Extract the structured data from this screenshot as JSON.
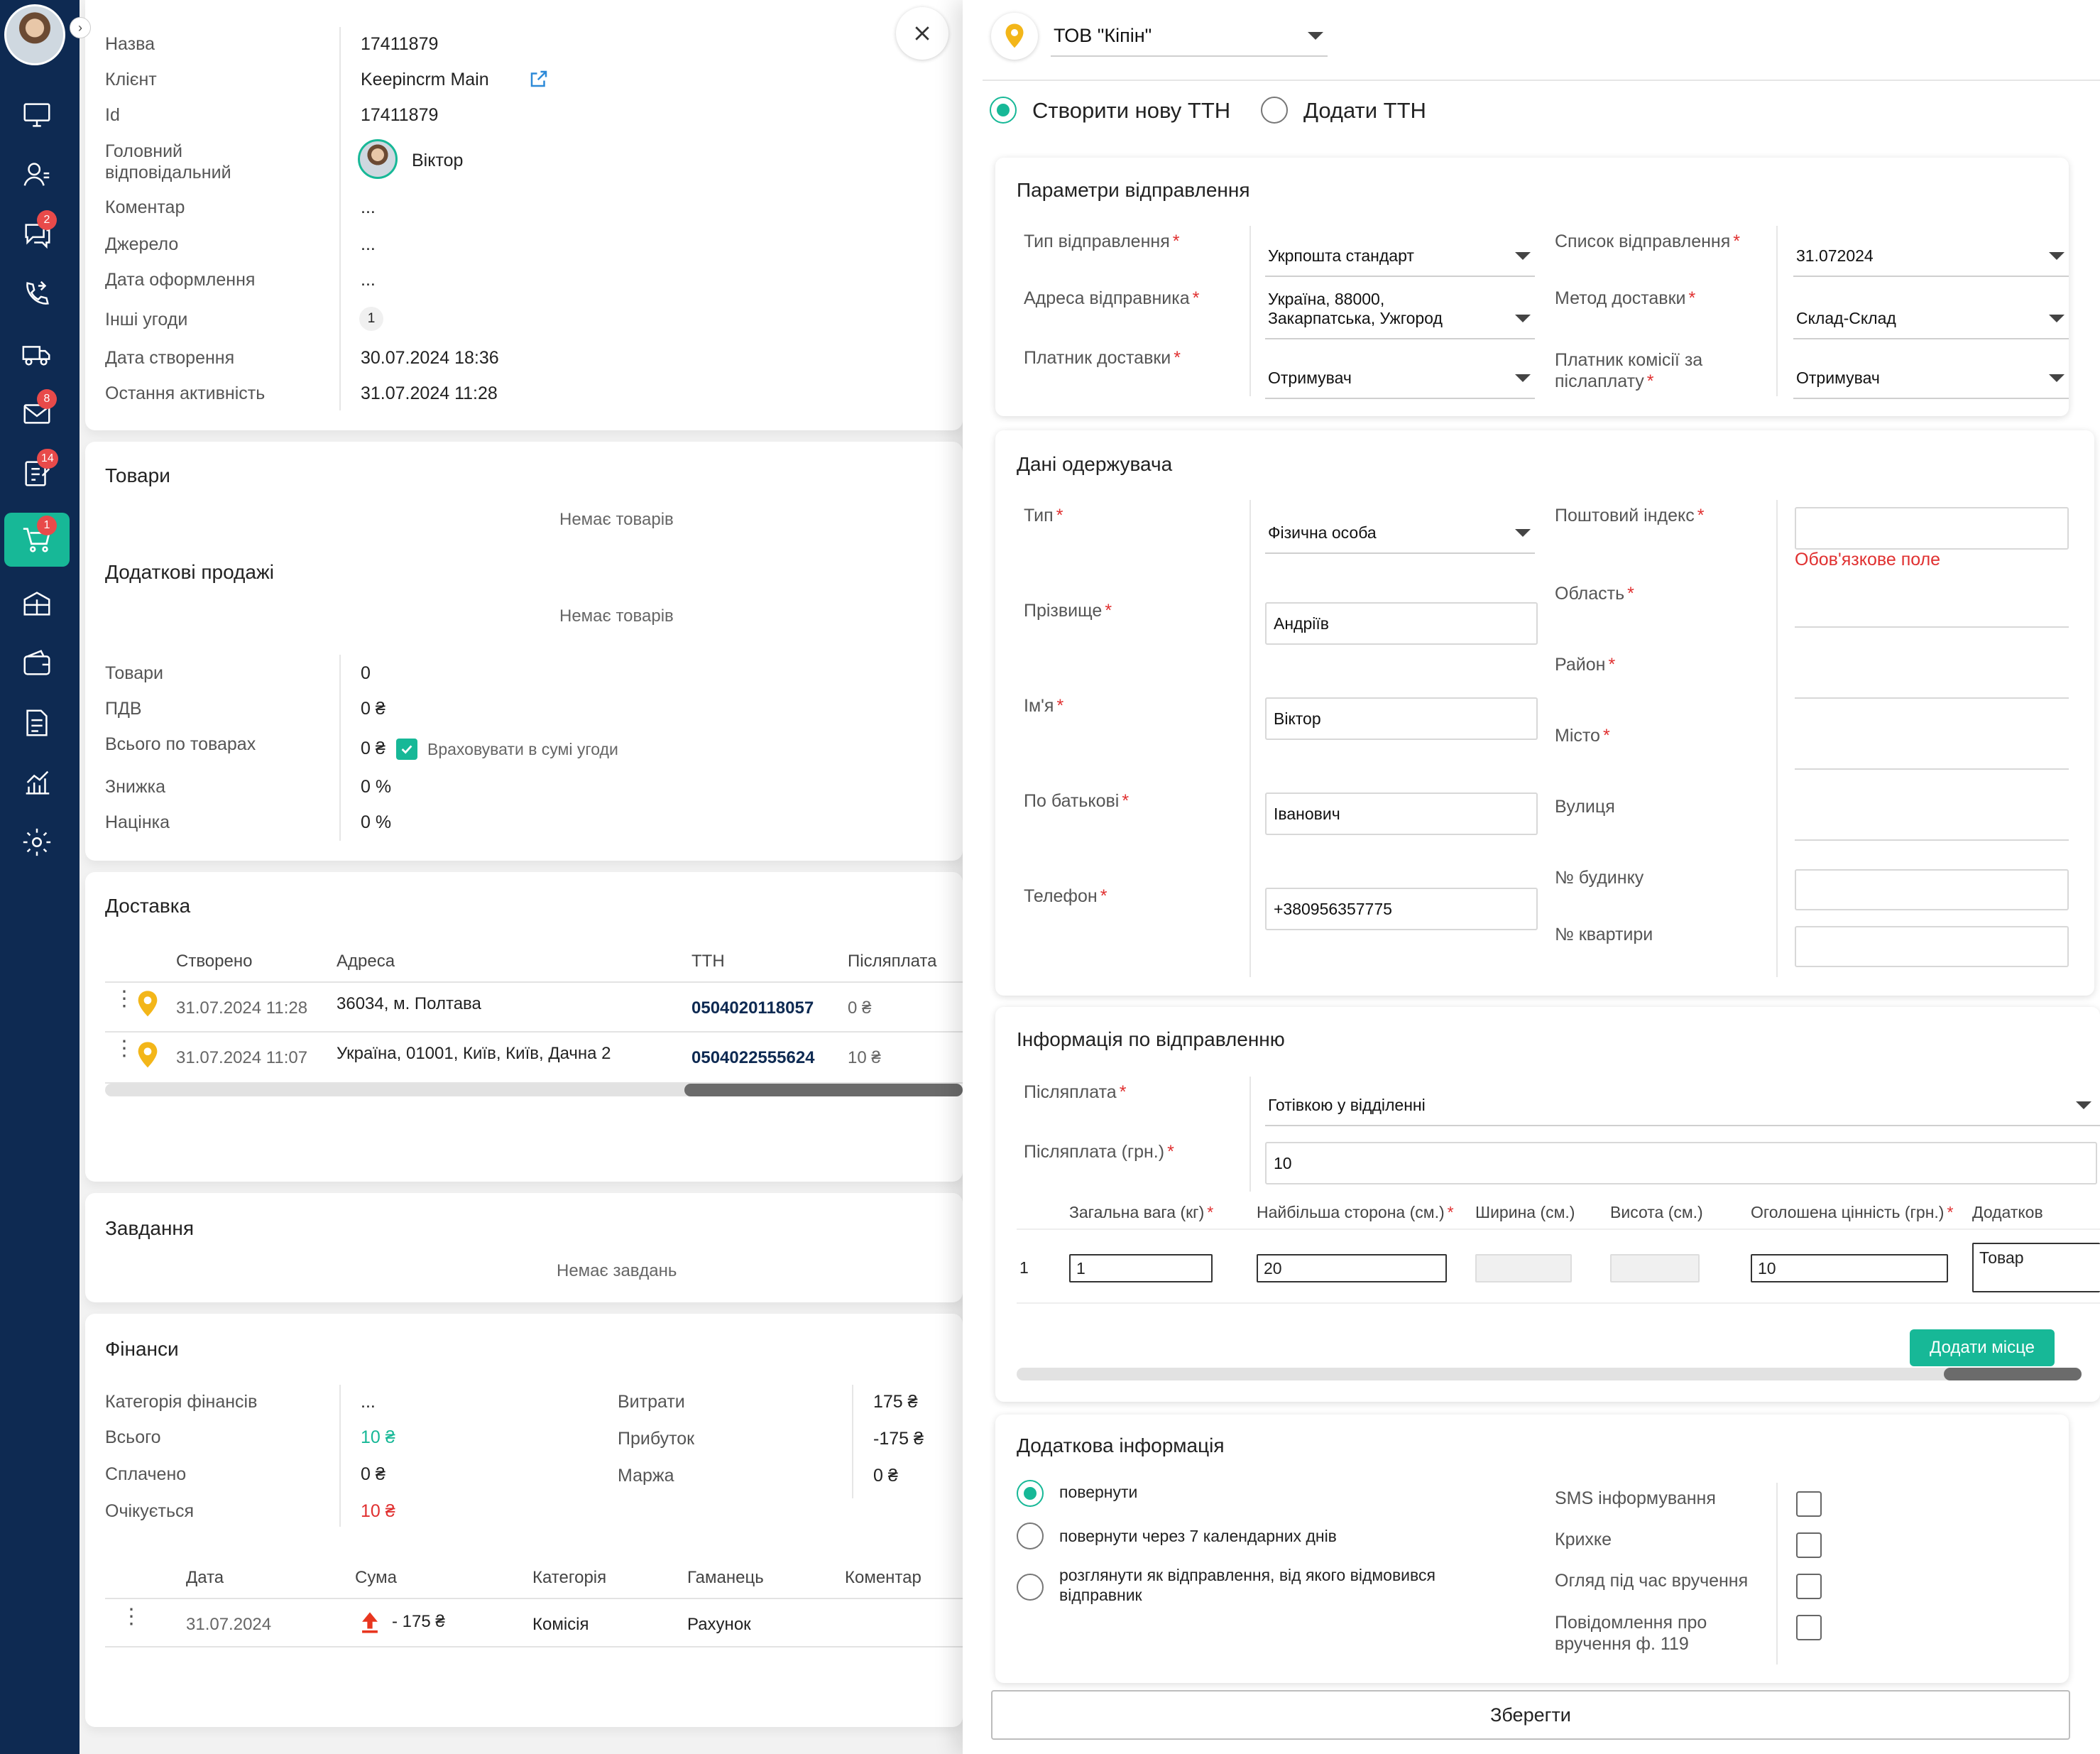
{
  "sidebar": {
    "badges": {
      "chats": "2",
      "mail": "8",
      "tasks": "14",
      "orders": "1"
    }
  },
  "deal": {
    "rows": [
      {
        "label": "Назва",
        "value": "17411879"
      },
      {
        "label": "Клієнт",
        "value": "Keepincrm Main"
      },
      {
        "label": "Id",
        "value": "17411879"
      },
      {
        "label": "Головний\nвідповідальний",
        "value": "Віктор"
      },
      {
        "label": "Коментар",
        "value": "..."
      },
      {
        "label": "Джерело",
        "value": "..."
      },
      {
        "label": "Дата оформлення",
        "value": "..."
      },
      {
        "label": "Інші угоди",
        "value": "1"
      },
      {
        "label": "Дата створення",
        "value": "30.07.2024 18:36"
      },
      {
        "label": "Остання активність",
        "value": "31.07.2024 11:28"
      }
    ]
  },
  "goods": {
    "title": "Товари",
    "empty": "Немає товарів",
    "extra_title": "Додаткові продажі",
    "extra_empty": "Немає товарів",
    "summary": [
      {
        "label": "Товари",
        "value": "0"
      },
      {
        "label": "ПДВ",
        "value": "0 ₴"
      },
      {
        "label": "Всього по товарах",
        "value": "0 ₴"
      },
      {
        "label": "Знижка",
        "value": "0 %"
      },
      {
        "label": "Націнка",
        "value": "0 %"
      }
    ],
    "include_label": "Враховувати в сумі угоди"
  },
  "delivery": {
    "title": "Доставка",
    "headers": [
      "Створено",
      "Адреса",
      "ТТН",
      "Післяплата"
    ],
    "rows": [
      {
        "created": "31.07.2024 11:28",
        "address": "36034, м. Полтава",
        "ttn": "0504020118057",
        "cod": "0 ₴"
      },
      {
        "created": "31.07.2024 11:07",
        "address": "Україна, 01001, Київ, Київ, Дачна 2",
        "ttn": "0504022555624",
        "cod": "10 ₴"
      }
    ]
  },
  "tasks": {
    "title": "Завдання",
    "empty": "Немає завдань"
  },
  "finance": {
    "title": "Фінанси",
    "left": [
      {
        "label": "Категорія фінансів",
        "value": "..."
      },
      {
        "label": "Всього",
        "value": "10 ₴"
      },
      {
        "label": "Сплачено",
        "value": "0 ₴"
      },
      {
        "label": "Очікується",
        "value": "10 ₴"
      }
    ],
    "right": [
      {
        "label": "Витрати",
        "value": "175 ₴"
      },
      {
        "label": "Прибуток",
        "value": "-175 ₴"
      },
      {
        "label": "Маржа",
        "value": "0 ₴"
      }
    ],
    "headers": [
      "Дата",
      "Сума",
      "Категорія",
      "Гаманець",
      "Коментар"
    ],
    "row": {
      "date": "31.07.2024",
      "sum": "- 175 ₴",
      "category": "Комісія",
      "wallet": "Рахунок"
    }
  },
  "ttn": {
    "company": "ТОВ \"Кіпін\"",
    "mode_new": "Створити нову ТТН",
    "mode_add": "Додати ТТН",
    "params": {
      "title": "Параметри відправлення",
      "type_label": "Тип відправлення",
      "type_value": "Укрпошта стандарт",
      "list_label": "Список відправлення",
      "list_value": "31.072024",
      "sender_label": "Адреса відправника",
      "sender_value": "Україна, 88000,\nЗакарпатська, Ужгород",
      "method_label": "Метод доставки",
      "method_value": "Склад-Склад",
      "payer_label": "Платник доставки",
      "payer_value": "Отримувач",
      "cod_payer_label": "Платник комісії за\nпіслаплату",
      "cod_payer_value": "Отримувач"
    },
    "recipient": {
      "title": "Дані одержувача",
      "type_label": "Тип",
      "type_value": "Фізична особа",
      "surname_label": "Прізвище",
      "surname_value": "Андріїв",
      "name_label": "Ім'я",
      "name_value": "Віктор",
      "patronymic_label": "По батькові",
      "patronymic_value": "Іванович",
      "phone_label": "Телефон",
      "phone_value": "+380956357775",
      "zip_label": "Поштовий індекс",
      "zip_error": "Обов'язкове поле",
      "region_label": "Область",
      "district_label": "Район",
      "city_label": "Місто",
      "street_label": "Вулиця",
      "house_label": "№ будинку",
      "apt_label": "№ квартири"
    },
    "shipment": {
      "title": "Інформація по відправленню",
      "cod_label": "Післяплата",
      "cod_value": "Готівкою у відділенні",
      "cod_amount_label": "Післяплата (грн.)",
      "cod_amount_value": "10",
      "headers": [
        "Загальна вага (кг)",
        "Найбільша сторона (см.)",
        "Ширина (см.)",
        "Висота (см.)",
        "Оголошена цінність (грн.)",
        "Додатков"
      ],
      "row": {
        "n": "1",
        "weight": "1",
        "side": "20",
        "value": "10",
        "extra": "Товар"
      },
      "add_place": "Додати місце"
    },
    "extra": {
      "title": "Додаткова інформація",
      "options": [
        "повернути",
        "повернути через 7 календарних днів",
        "розглянути як відправлення, від якого відмовився\nвідправник"
      ],
      "checks": [
        "SMS інформування",
        "Крихке",
        "Огляд під час вручення",
        "Повідомлення про\nвручення ф. 119"
      ]
    },
    "save": "Зберегти"
  },
  "colors": {
    "accent": "#17b897",
    "sidebar": "#0e2a52",
    "error": "#e03030",
    "link": "#0e2a52"
  }
}
